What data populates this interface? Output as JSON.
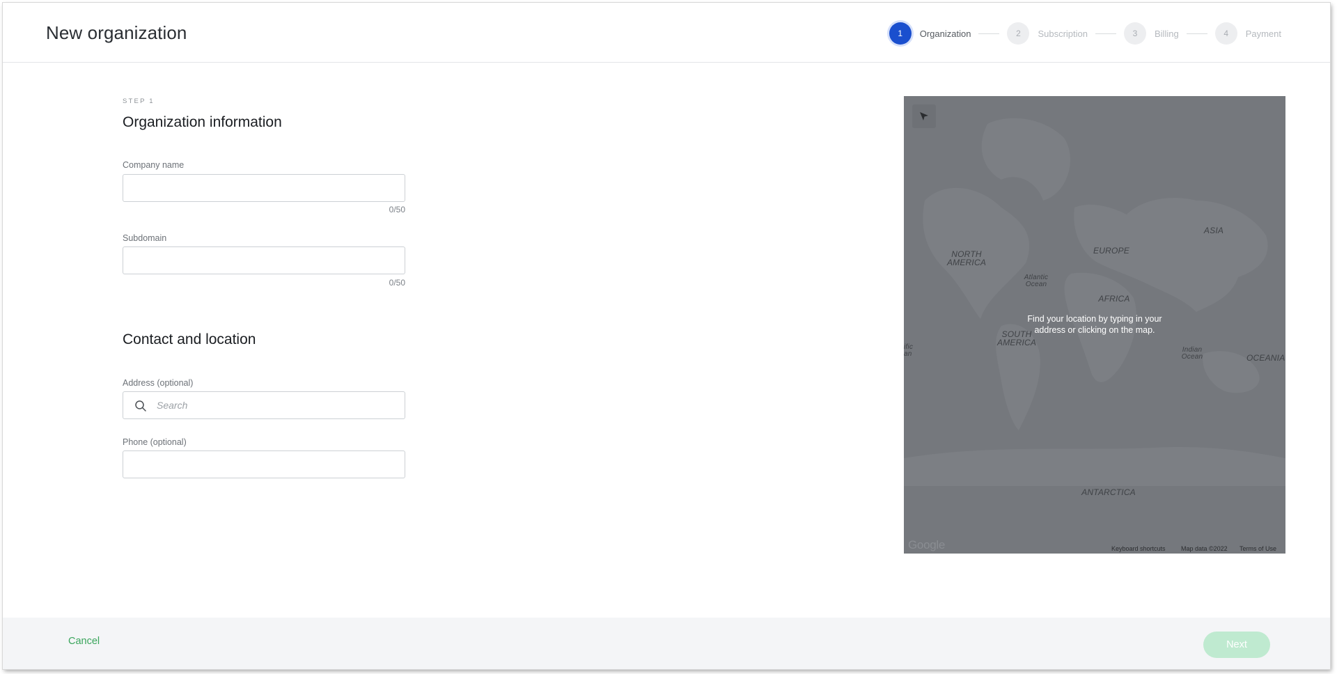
{
  "header": {
    "title": "New organization",
    "steps": [
      {
        "number": "1",
        "label": "Organization",
        "active": true
      },
      {
        "number": "2",
        "label": "Subscription",
        "active": false
      },
      {
        "number": "3",
        "label": "Billing",
        "active": false
      },
      {
        "number": "4",
        "label": "Payment",
        "active": false
      }
    ]
  },
  "form": {
    "kicker": "STEP 1",
    "section1_title": "Organization information",
    "company_name": {
      "label": "Company name",
      "value": "",
      "counter": "0/50"
    },
    "subdomain": {
      "label": "Subdomain",
      "value": "",
      "counter": "0/50"
    },
    "section2_title": "Contact and location",
    "address": {
      "label": "Address (optional)",
      "placeholder": "Search",
      "value": ""
    },
    "phone": {
      "label": "Phone (optional)",
      "value": ""
    }
  },
  "map": {
    "hint": "Find your location by typing in your address or clicking on the map.",
    "labels": {
      "north_america": "NORTH AMERICA",
      "atlantic_ocean": "Atlantic Ocean",
      "europe": "EUROPE",
      "asia": "ASIA",
      "africa": "AFRICA",
      "south_america": "SOUTH AMERICA",
      "indian_ocean": "Indian Ocean",
      "oceania": "OCEANIA",
      "pacific_ocean": "ific an",
      "antarctica": "ANTARCTICA"
    },
    "google": "Google",
    "keyboard_shortcuts": "Keyboard shortcuts",
    "map_data": "Map data ©2022",
    "terms": "Terms of Use",
    "locate_icon": "navigation-arrow-icon"
  },
  "footer": {
    "cancel_label": "Cancel",
    "next_label": "Next"
  },
  "colors": {
    "primary": "#1a4fce",
    "success": "#3aa55c",
    "next_disabled": "#bfead0",
    "map_bg": "#75787d"
  }
}
